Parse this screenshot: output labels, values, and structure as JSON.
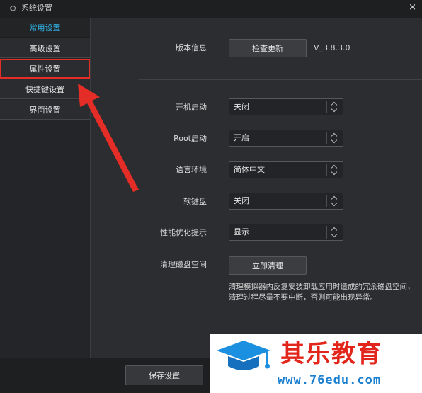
{
  "window": {
    "title": "系统设置",
    "close_glyph": "×",
    "icon": "gear-icon"
  },
  "sidebar": {
    "items": [
      {
        "label": "常用设置",
        "active": true
      },
      {
        "label": "高级设置"
      },
      {
        "label": "属性设置",
        "highlighted": true
      },
      {
        "label": "快捷键设置"
      },
      {
        "label": "界面设置"
      }
    ]
  },
  "settings": {
    "version": {
      "label": "版本信息",
      "button": "检查更新",
      "value": "V_3.8.3.0"
    },
    "autostart": {
      "label": "开机启动",
      "value": "关闭"
    },
    "root": {
      "label": "Root启动",
      "value": "开启"
    },
    "language": {
      "label": "语言环境",
      "value": "简体中文"
    },
    "soft_keyboard": {
      "label": "软键盘",
      "value": "关闭"
    },
    "perf_hint": {
      "label": "性能优化提示",
      "value": "显示"
    },
    "disk_cleanup": {
      "label": "清理磁盘空间",
      "button": "立即清理",
      "note": "清理模拟器内反复安装卸载应用时造成的冗余磁盘空间，清理过程尽量不要中断，否则可能出现异常。"
    }
  },
  "footer": {
    "save_label": "保存设置"
  },
  "watermark": {
    "title": "其乐教育",
    "url": "www.76edu.com"
  },
  "colors": {
    "accent": "#30b5e8",
    "annotation_red": "#e52d27",
    "watermark_blue": "#1b7fd0"
  }
}
